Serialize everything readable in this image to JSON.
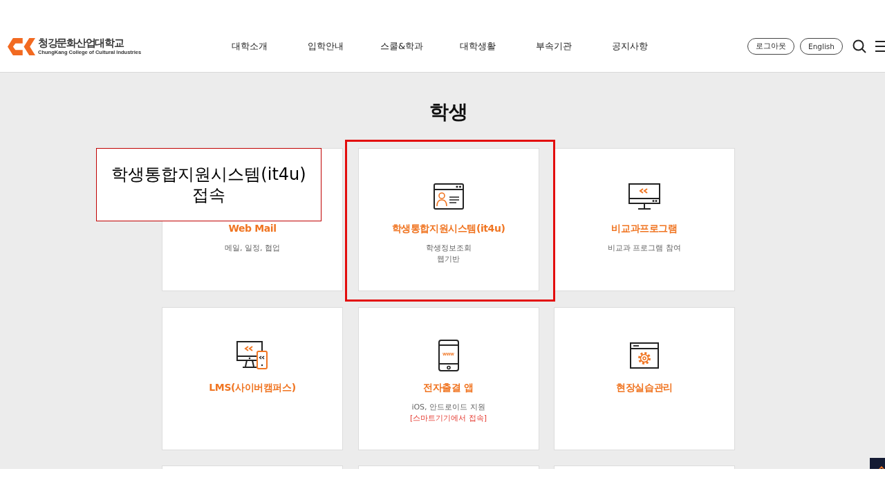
{
  "header": {
    "logo": {
      "name": "청강문화산업대학교",
      "subtitle": "ChungKang College of Cultural Industries"
    },
    "nav": [
      "대학소개",
      "입학안내",
      "스쿨&학과",
      "대학생활",
      "부속기관",
      "공지사항"
    ],
    "buttons": [
      "로그아웃",
      "English"
    ]
  },
  "page_title": "학생",
  "cards": [
    {
      "kind": "full",
      "title": "Web Mail",
      "description": [
        "메일, 일정, 협업"
      ],
      "highlighted": false
    },
    {
      "kind": "full",
      "title": "학생통합지원시스템(it4u)",
      "description": [
        "학생정보조회",
        "웹기반"
      ],
      "highlighted": true
    },
    {
      "kind": "full",
      "title": "비교과프로그램",
      "description": [
        "비교과 프로그램 참여"
      ],
      "highlighted": false
    },
    {
      "kind": "full",
      "title": "LMS(사이버캠퍼스)",
      "highlighted": false
    },
    {
      "kind": "full",
      "title": "전자출결 앱",
      "icon_text": "www",
      "description": [
        "iOS, 안드로이드 지원"
      ],
      "note": "[스마트기기에서 접속]",
      "highlighted": false
    },
    {
      "kind": "full",
      "title": "현장실습관리",
      "highlighted": false
    },
    {
      "kind": "cut",
      "highlighted": false
    },
    {
      "kind": "cut",
      "highlighted": false
    },
    {
      "kind": "cut",
      "highlighted": false
    }
  ],
  "callout": {
    "text": "학생통합지원시스템(it4u) 접속"
  }
}
